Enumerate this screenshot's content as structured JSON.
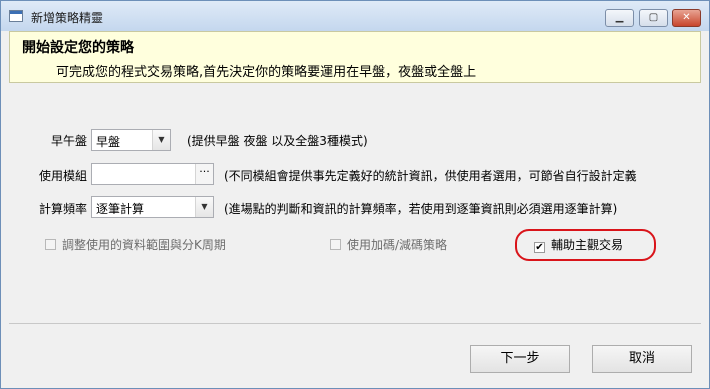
{
  "window": {
    "title": "新增策略精靈",
    "controls": {
      "minimize": "▁",
      "maximize": "▢",
      "close": "✕"
    }
  },
  "header": {
    "title": "開始設定您的策略",
    "subtitle": "可完成您的程式交易策略,首先決定你的策略要運用在早盤，夜盤或全盤上"
  },
  "form": {
    "session": {
      "label": "早午盤",
      "value": "早盤",
      "hint": "(提供早盤 夜盤 以及全盤3種模式)"
    },
    "module": {
      "label": "使用模組",
      "value": "",
      "button": "···",
      "hint": "(不同模組會提供事先定義好的統計資訊，供使用者選用，可節省自行設計定義"
    },
    "frequency": {
      "label": "計算頻率",
      "value": "逐筆計算",
      "hint": "(進場點的判斷和資訊的計算頻率，若使用到逐筆資訊則必須選用逐筆計算)"
    }
  },
  "checkboxes": [
    {
      "label": "調整使用的資料範圍與分K周期",
      "checked": false,
      "enabled": false
    },
    {
      "label": "使用加碼/減碼策略",
      "checked": false,
      "enabled": false
    },
    {
      "label": "輔助主觀交易",
      "checked": true,
      "enabled": true
    }
  ],
  "buttons": {
    "next": "下一步",
    "cancel": "取消"
  },
  "colors": {
    "highlight": "#d9141a",
    "header_bg": "#ffffdd"
  }
}
